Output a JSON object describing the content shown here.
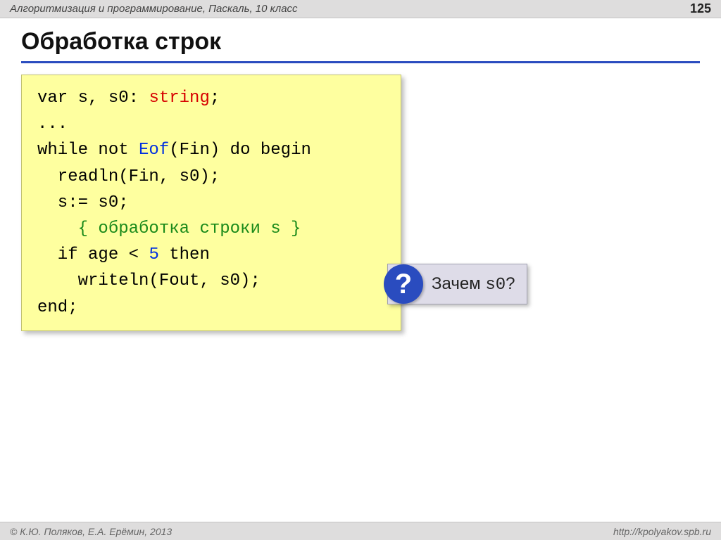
{
  "header": {
    "subject": "Алгоритмизация и программирование, Паскаль, 10 класс",
    "page_number": "125"
  },
  "title": "Обработка строк",
  "code": {
    "l1a": "var s, s0: ",
    "l1b": "string",
    "l1c": ";",
    "l2": "...",
    "l3a": "while not ",
    "l3b": "Eof",
    "l3c": "(Fin) do begin",
    "l4": "  readln(Fin, s0);",
    "l5": "  s:= s0;",
    "l6": "    { обработка строки s }",
    "l7a": "  if age < ",
    "l7b": "5",
    "l7c": " then",
    "l8": "    writeln(Fout, s0);",
    "l9": "end;"
  },
  "callout": {
    "badge": "?",
    "text_prefix": "Зачем ",
    "text_mono": "s0",
    "text_suffix": "?"
  },
  "footer": {
    "copyright": "© К.Ю. Поляков, Е.А. Ерёмин, 2013",
    "url": "http://kpolyakov.spb.ru"
  }
}
